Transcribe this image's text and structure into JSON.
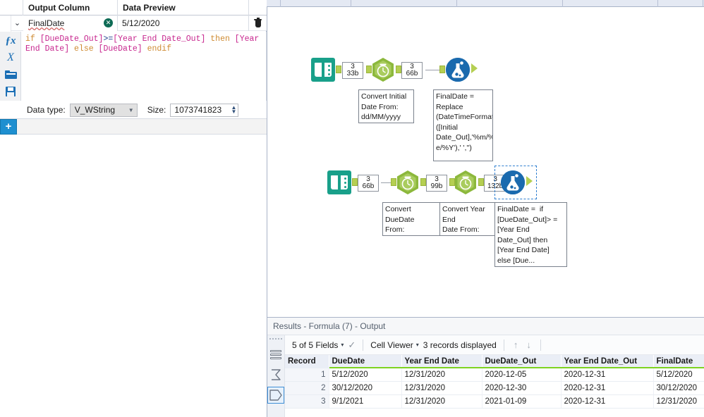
{
  "config_panel": {
    "headers": {
      "grip": "",
      "output_column": "Output Column",
      "data_preview": "Data Preview",
      "trash": ""
    },
    "row": {
      "field_name": "FinalDate",
      "preview_value": "5/12/2020",
      "clear_glyph": "✕",
      "caret_glyph": "⌄"
    },
    "formula": {
      "tokens": [
        {
          "t": "if ",
          "c": "kw"
        },
        {
          "t": "[DueDate_Out]",
          "c": "fld"
        },
        {
          "t": ">=",
          "c": "op"
        },
        {
          "t": "[Year End Date_Out]",
          "c": "fld"
        },
        {
          "t": " then ",
          "c": "kw"
        },
        {
          "t": "[Year End Date]",
          "c": "fld"
        },
        {
          "t": " else ",
          "c": "kw"
        },
        {
          "t": "[DueDate]",
          "c": "fld"
        },
        {
          "t": " endif",
          "c": "kw"
        }
      ],
      "plain": "if [DueDate_Out]>=[Year End Date_Out] then [Year End Date] else [DueDate] endif"
    },
    "rail": {
      "fx": "ƒx",
      "xv": "X",
      "folder": "open-file",
      "save": "save-file"
    },
    "data_type": {
      "label": "Data type:",
      "value": "V_WString",
      "caret": "▼",
      "size_label": "Size:",
      "size_value": "1073741823",
      "spin_up": "▲",
      "spin_down": "▼"
    },
    "add_button": "+"
  },
  "canvas": {
    "rows": [
      {
        "tools": [
          {
            "type": "text-input-tool",
            "icon": "book-icon"
          },
          {
            "type": "datetime-tool",
            "icon": "clock-hexagon-icon",
            "annotation": "Convert Initial\nDate From:\ndd/MM/yyyy"
          },
          {
            "type": "formula-tool",
            "icon": "flask-icon",
            "annotation": "FinalDate =\nReplace\n(DateTimeFormat\n([Initial\nDate_Out],'%m/%\ne/%Y'),' ','')",
            "selected": false
          }
        ],
        "connections": [
          {
            "records": "3",
            "size": "33b"
          },
          {
            "records": "3",
            "size": "66b"
          }
        ]
      },
      {
        "tools": [
          {
            "type": "text-input-tool",
            "icon": "book-icon"
          },
          {
            "type": "datetime-tool",
            "icon": "clock-hexagon-icon",
            "annotation": "Convert DueDate\nFrom:\ndd/MM/yyyy"
          },
          {
            "type": "datetime-tool",
            "icon": "clock-hexagon-icon",
            "annotation": "Convert Year End\nDate From:\nMM/dd/yyyy"
          },
          {
            "type": "formula-tool",
            "icon": "flask-icon",
            "annotation": "FinalDate =  if\n[DueDate_Out]> =\n[Year End\nDate_Out] then\n[Year End Date]\nelse [Due...",
            "selected": true
          }
        ],
        "connections": [
          {
            "records": "3",
            "size": "66b"
          },
          {
            "records": "3",
            "size": "99b"
          },
          {
            "records": "3",
            "size": "132b"
          }
        ]
      }
    ]
  },
  "results": {
    "title": "Results - Formula (7) - Output",
    "toolbar": {
      "fields": "5 of 5 Fields",
      "caret": "▾",
      "check": "✓",
      "cell_viewer": "Cell Viewer",
      "records": "3 records displayed",
      "up_arrow": "↑",
      "down_arrow": "↓"
    },
    "rail_icons": [
      "stacked-rows-icon",
      "sigma-icon",
      "tag-outline-icon"
    ],
    "table": {
      "columns": [
        "Record",
        "DueDate",
        "Year End Date",
        "DueDate_Out",
        "Year End Date_Out",
        "FinalDate"
      ],
      "rows": [
        [
          "1",
          "5/12/2020",
          "12/31/2020",
          "2020-12-05",
          "2020-12-31",
          "5/12/2020"
        ],
        [
          "2",
          "30/12/2020",
          "12/31/2020",
          "2020-12-30",
          "2020-12-31",
          "30/12/2020"
        ],
        [
          "3",
          "9/1/2021",
          "12/31/2020",
          "2021-01-09",
          "2020-12-31",
          "12/31/2020"
        ]
      ]
    }
  },
  "colors": {
    "teal": "#19a08a",
    "hex_green": "#8cb83c",
    "blue": "#1a6aae",
    "plug_green": "#b5cf52",
    "accent_blue": "#1e8fd0",
    "grid_underline": "#7ed321",
    "selection": "#2f7fd0"
  }
}
